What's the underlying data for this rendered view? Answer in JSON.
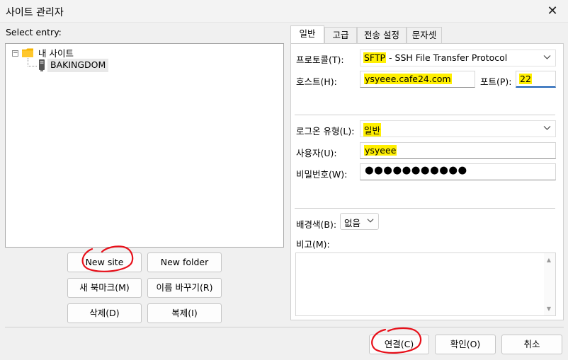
{
  "window": {
    "title": "사이트 관리자",
    "close_glyph": "✕"
  },
  "left": {
    "select_entry_label": "Select entry:",
    "tree": {
      "root_label": "내 사이트",
      "root_expander": "−",
      "children": [
        {
          "label": "BAKINGDOM",
          "icon": "server-icon"
        }
      ]
    },
    "buttons": {
      "new_site": "New site",
      "new_folder": "New folder",
      "new_bookmark": "새 북마크(M)",
      "rename": "이름 바꾸기(R)",
      "delete": "삭제(D)",
      "duplicate": "복제(I)"
    }
  },
  "tabs": [
    {
      "label": "일반",
      "active": true
    },
    {
      "label": "고급",
      "active": false
    },
    {
      "label": "전송 설정",
      "active": false
    },
    {
      "label": "문자셋",
      "active": false
    }
  ],
  "general": {
    "protocol_label": "프로토콜(T):",
    "protocol_value_hl": "SFTP",
    "protocol_value_rest": " - SSH File Transfer Protocol",
    "host_label": "호스트(H):",
    "host_value": "ysyeee.cafe24.com",
    "port_label": "포트(P):",
    "port_value": "22",
    "logon_type_label": "로그온 유형(L):",
    "logon_type_value": "일반",
    "user_label": "사용자(U):",
    "user_value": "ysyeee",
    "password_label": "비밀번호(W):",
    "password_mask": "●●●●●●●●●●●",
    "bgcolor_label": "배경색(B):",
    "bgcolor_value": "없음",
    "comments_label": "비고(M):",
    "comments_value": ""
  },
  "footer": {
    "connect": "연결(C)",
    "ok": "확인(O)",
    "cancel": "취소"
  },
  "colors": {
    "highlight": "#ffef00",
    "annotation": "#e8101a",
    "folder": "#f5b400"
  }
}
